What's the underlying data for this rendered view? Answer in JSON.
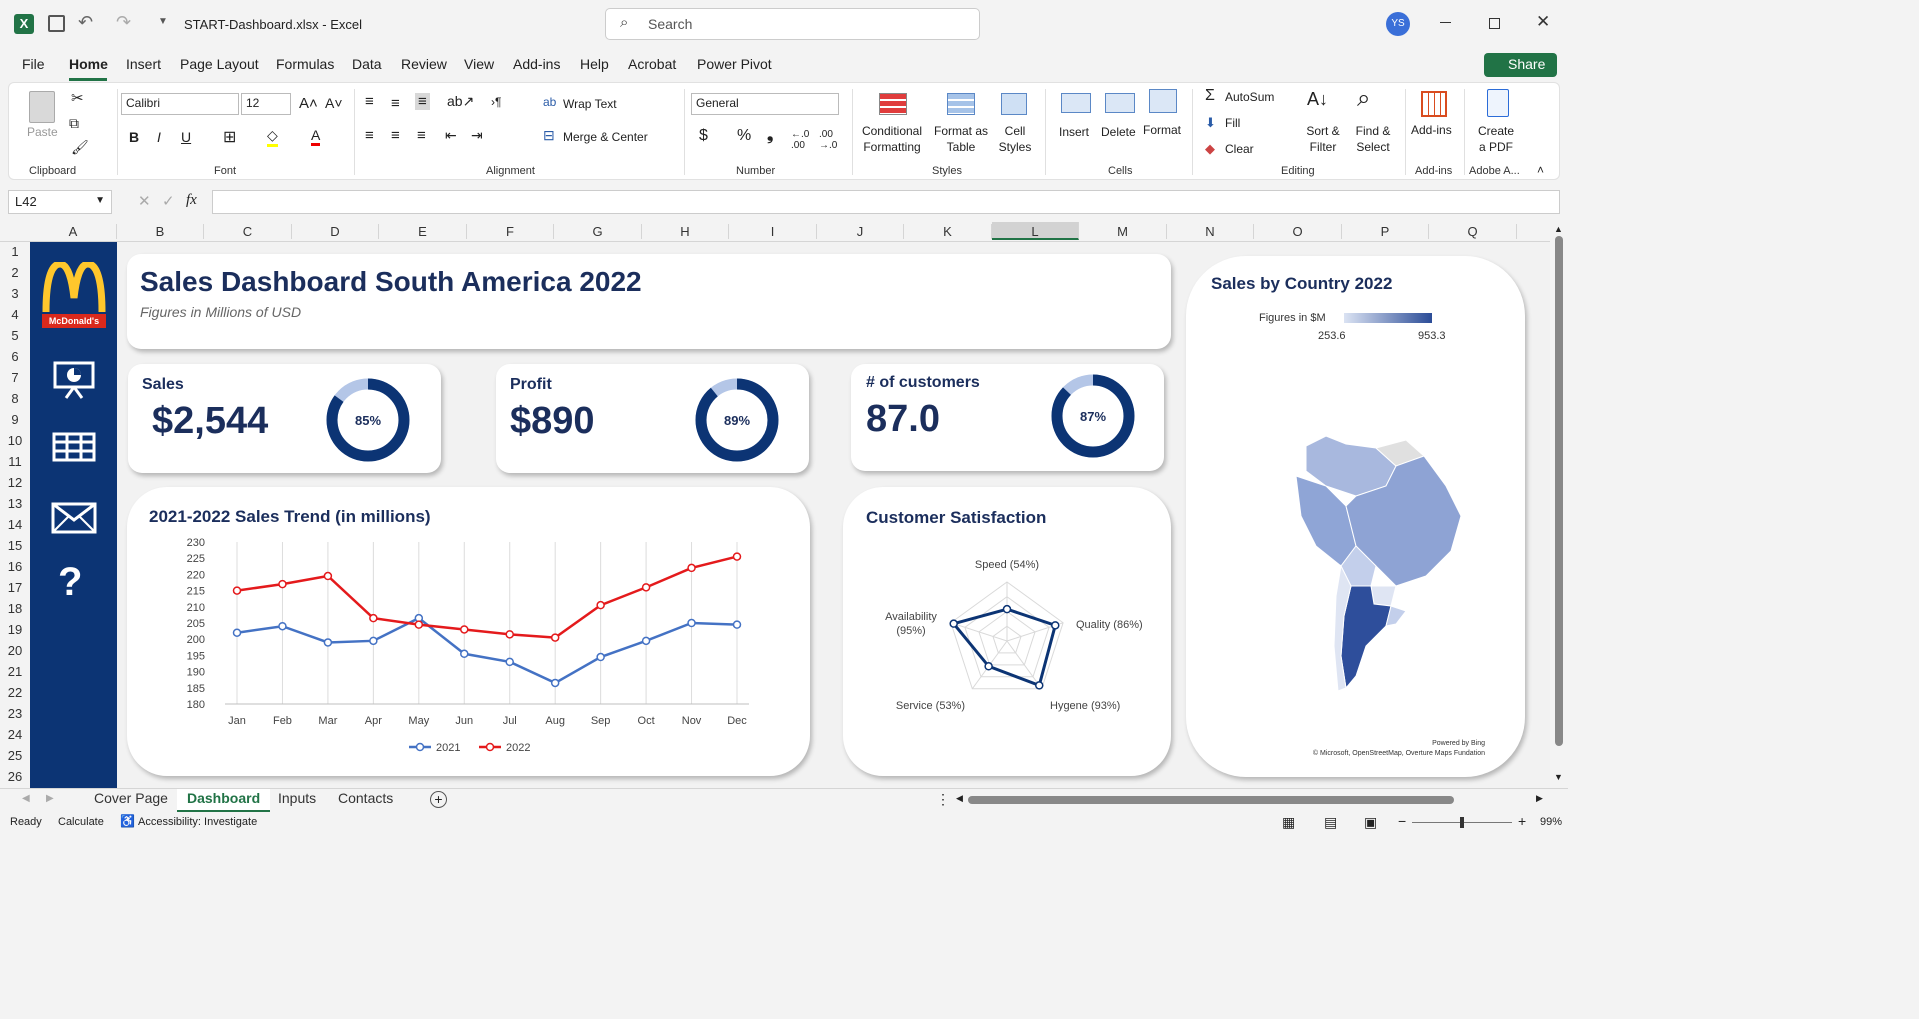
{
  "app": {
    "file_name": "START-Dashboard.xlsx",
    "separator": "-",
    "app_name": "Excel",
    "search_placeholder": "Search",
    "user_initials": "YS",
    "share_label": "Share"
  },
  "menu": [
    "File",
    "Home",
    "Insert",
    "Page Layout",
    "Formulas",
    "Data",
    "Review",
    "View",
    "Add-ins",
    "Help",
    "Acrobat",
    "Power Pivot"
  ],
  "ribbon": {
    "clipboard": {
      "paste": "Paste",
      "label": "Clipboard"
    },
    "font": {
      "family": "Calibri",
      "size": "12",
      "label": "Font"
    },
    "alignment": {
      "wrap": "Wrap Text",
      "merge": "Merge & Center",
      "label": "Alignment"
    },
    "number": {
      "format": "General",
      "label": "Number"
    },
    "styles": {
      "conditional": "Conditional",
      "conditional2": "Formatting",
      "format_table": "Format as",
      "format_table2": "Table",
      "cell_styles": "Cell",
      "cell_styles2": "Styles",
      "label": "Styles"
    },
    "cells": {
      "insert": "Insert",
      "delete": "Delete",
      "format": "Format",
      "label": "Cells"
    },
    "editing": {
      "autosum": "AutoSum",
      "fill": "Fill",
      "clear": "Clear",
      "sort": "Sort &",
      "sort2": "Filter",
      "find": "Find &",
      "find2": "Select",
      "label": "Editing"
    },
    "addins": {
      "btn": "Add-ins",
      "label": "Add-ins"
    },
    "adobe": {
      "btn": "Create",
      "btn2": "a PDF",
      "label": "Adobe A..."
    }
  },
  "formula_bar": {
    "name_box": "L42",
    "fx": "fx",
    "value": ""
  },
  "columns": [
    "A",
    "B",
    "C",
    "D",
    "E",
    "F",
    "G",
    "H",
    "I",
    "J",
    "K",
    "L",
    "M",
    "N",
    "O",
    "P",
    "Q"
  ],
  "rows": [
    "1",
    "2",
    "3",
    "4",
    "5",
    "6",
    "7",
    "8",
    "9",
    "10",
    "11",
    "12",
    "13",
    "14",
    "15",
    "16",
    "17",
    "18",
    "19",
    "20",
    "21",
    "22",
    "23",
    "24",
    "25",
    "26"
  ],
  "dashboard": {
    "title": "Sales Dashboard South America 2022",
    "subtitle": "Figures in Millions of USD",
    "logo_text": "McDonald's",
    "help_glyph": "?",
    "kpis": [
      {
        "title": "Sales",
        "value": "$2,544",
        "pct_label": "85%",
        "pct": 0.85
      },
      {
        "title": "Profit",
        "value": "$890",
        "pct_label": "89%",
        "pct": 0.89
      },
      {
        "title": "# of customers",
        "value": "87.0",
        "pct_label": "87%",
        "pct": 0.87
      }
    ],
    "trend_title": "2021-2022 Sales Trend (in millions)",
    "satisfaction_title": "Customer Satisfaction",
    "map": {
      "title": "Sales by Country 2022",
      "legend_label": "Figures in $M",
      "legend_min": "253.6",
      "legend_max": "953.3",
      "credit1": "Powered by Bing",
      "credit2": "© Microsoft, OpenStreetMap, Overture Maps Fundation"
    }
  },
  "chart_data": [
    {
      "type": "line",
      "title": "2021-2022 Sales Trend (in millions)",
      "categories": [
        "Jan",
        "Feb",
        "Mar",
        "Apr",
        "May",
        "Jun",
        "Jul",
        "Aug",
        "Sep",
        "Oct",
        "Nov",
        "Dec"
      ],
      "ylim": [
        180,
        230
      ],
      "yticks": [
        180,
        185,
        190,
        195,
        200,
        205,
        210,
        215,
        220,
        225,
        230
      ],
      "series": [
        {
          "name": "2021",
          "color": "#4472c4",
          "values": [
            202,
            204,
            199,
            199.5,
            206.5,
            195.5,
            193,
            186.5,
            194.5,
            199.5,
            205,
            204.5
          ]
        },
        {
          "name": "2022",
          "color": "#e41a1c",
          "values": [
            215,
            217,
            219.5,
            206.5,
            204.5,
            203,
            201.5,
            200.5,
            210.5,
            216,
            222,
            225.5
          ]
        }
      ],
      "legend": "bottom",
      "grid": "vertical"
    },
    {
      "type": "radar",
      "title": "Customer Satisfaction",
      "categories": [
        "Speed (54%)",
        "Quality (86%)",
        "Hygene (93%)",
        "Service (53%)",
        "Availability (95%)"
      ],
      "values": [
        54,
        86,
        93,
        53,
        95
      ],
      "rmax": 100
    }
  ],
  "tabs": [
    "Cover Page",
    "Dashboard",
    "Inputs",
    "Contacts"
  ],
  "active_tab": "Dashboard",
  "status": {
    "ready": "Ready",
    "calc": "Calculate",
    "accessibility": "Accessibility: Investigate",
    "zoom": "99%"
  },
  "colors": {
    "navy": "#1b2e5c",
    "sidebar": "#0c3474",
    "excel_green": "#217346"
  }
}
